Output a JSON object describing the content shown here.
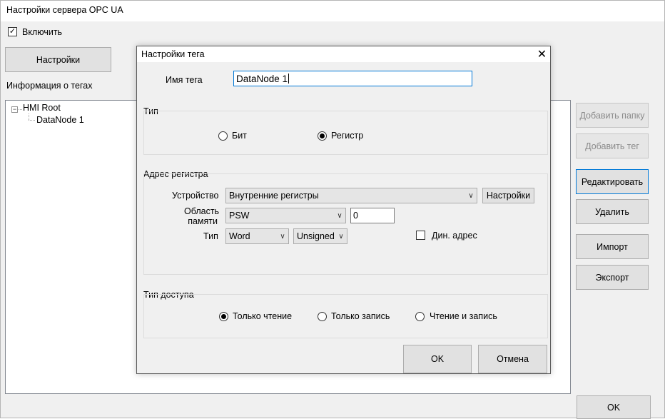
{
  "main_window": {
    "title": "Настройки сервера OPC UA",
    "enable_label": "Включить",
    "enable_checked": true,
    "settings_button": "Настройки",
    "tags_info_label": "Информация о тегах",
    "tree": {
      "root": "HMI Root",
      "children": [
        "DataNode 1"
      ]
    },
    "buttons": {
      "add_folder": "Добавить папку",
      "add_tag": "Добавить тег",
      "edit": "Редактировать",
      "delete": "Удалить",
      "import": "Импорт",
      "export": "Экспорт",
      "ok": "OK"
    }
  },
  "dialog": {
    "title": "Настройки тега",
    "close_glyph": "✕",
    "tag_name_label": "Имя тега",
    "tag_name_value": "DataNode 1",
    "type_group": {
      "label": "Тип",
      "options": [
        "Бит",
        "Регистр"
      ],
      "selected": "Регистр"
    },
    "register_address": {
      "label": "Адрес регистра",
      "device_label": "Устройство",
      "device_value": "Внутренние регистры",
      "device_settings_button": "Настройки",
      "memory_area_label": "Область\nпамяти",
      "memory_area_value": "PSW",
      "offset_value": "0",
      "type_label": "Тип",
      "data_type_value": "Word",
      "sign_value": "Unsigned",
      "dynamic_address_label": "Дин. адрес",
      "dynamic_address_checked": false
    },
    "access_group": {
      "label": "Тип доступа",
      "options": [
        "Только чтение",
        "Только запись",
        "Чтение и запись"
      ],
      "selected": "Только чтение"
    },
    "ok_button": "OK",
    "cancel_button": "Отмена"
  },
  "icons": {
    "check": "✓",
    "chevron_down": "∨",
    "tree_collapse": "−"
  }
}
